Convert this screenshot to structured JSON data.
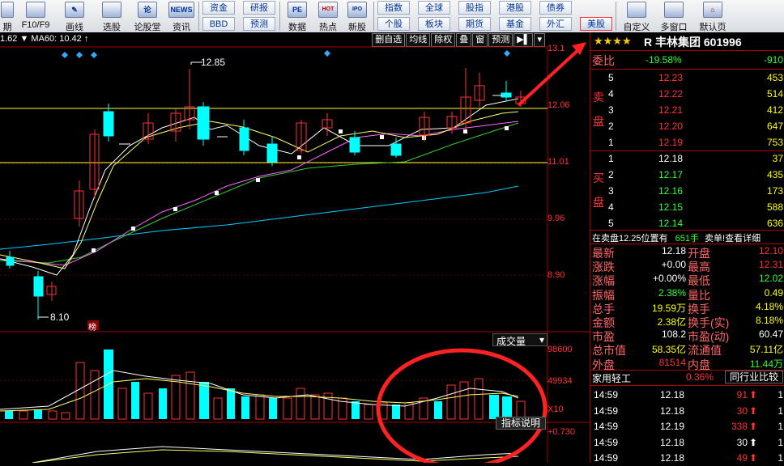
{
  "toolbar": {
    "icon_buttons": [
      {
        "label": "期",
        "icon": "calendar-icon"
      },
      {
        "label": "F10/F9",
        "icon": "f10-icon"
      },
      {
        "label": "画线",
        "icon": "pen-icon"
      },
      {
        "label": "选股",
        "icon": "select-stock-icon"
      },
      {
        "label": "论股堂",
        "icon": "forum-icon",
        "icon_text": "论"
      },
      {
        "label": "资讯",
        "icon": "news-icon",
        "icon_text": "NEWS"
      }
    ],
    "grid1": [
      "资金",
      "研报",
      "BBD",
      "预测"
    ],
    "icon_buttons2": [
      {
        "label": "数据",
        "icon": "data-icon",
        "icon_text": "PE"
      },
      {
        "label": "热点",
        "icon": "hot-icon",
        "icon_text": "HOT"
      },
      {
        "label": "新股",
        "icon": "ipo-icon",
        "icon_text": "IPO"
      }
    ],
    "grid2": [
      "指数",
      "全球",
      "股指",
      "港股",
      "债券",
      "个股",
      "板块",
      "期货",
      "基金",
      "外汇",
      "美股"
    ],
    "right_buttons": [
      {
        "label": "自定义",
        "icon": "custom-icon"
      },
      {
        "label": "多窗口",
        "icon": "multi-window-icon"
      },
      {
        "label": "默认页",
        "icon": "home-icon"
      }
    ]
  },
  "chart": {
    "ma_text": "1.62  ▼  MA60: 10.42 ↑",
    "tabs": [
      "删自选",
      "均线",
      "除权",
      "叠",
      "窗",
      "预测"
    ],
    "price_ticks": [
      "13.1",
      "12.06",
      "11.01",
      "9.96",
      "8.90"
    ],
    "high_label": "12.85",
    "low_label": "8.10",
    "bang_label": "榜",
    "volume_title": "成交量",
    "volume_ticks": [
      "98600",
      "49934",
      "X10"
    ],
    "indicator_button": "指标说明",
    "indicator_tick": "+0.730"
  },
  "quote": {
    "stars": "★★★★",
    "title": "R 丰林集团 601996",
    "weibi_label": "委比",
    "weibi_pct": "-19.58%",
    "weibi_diff": "-910",
    "sell_label": "卖盘",
    "buy_label": "买盘",
    "sell": [
      {
        "n": "5",
        "price": "12.23",
        "vol": "453"
      },
      {
        "n": "4",
        "price": "12.22",
        "vol": "514"
      },
      {
        "n": "3",
        "price": "12.21",
        "vol": "412"
      },
      {
        "n": "2",
        "price": "12.20",
        "vol": "647"
      },
      {
        "n": "1",
        "price": "12.19",
        "vol": "753"
      }
    ],
    "buy": [
      {
        "n": "1",
        "price": "12.18",
        "vol": "37"
      },
      {
        "n": "2",
        "price": "12.17",
        "vol": "435"
      },
      {
        "n": "3",
        "price": "12.16",
        "vol": "173"
      },
      {
        "n": "4",
        "price": "12.15",
        "vol": "588"
      },
      {
        "n": "5",
        "price": "12.14",
        "vol": "636"
      }
    ],
    "notice_text": "在卖盘12.25位置有",
    "notice_vol": "651手",
    "notice_link": "卖单!查看详细",
    "stats": [
      [
        "最新",
        "12.18",
        "开盘",
        "12.10"
      ],
      [
        "涨跌",
        "+0.00",
        "最高",
        "12.31"
      ],
      [
        "涨幅",
        "+0.00%",
        "最低",
        "12.02"
      ],
      [
        "振幅",
        "2.38%",
        "量比",
        "0.49"
      ],
      [
        "总手",
        "19.59万",
        "换手",
        "4.18%"
      ],
      [
        "金额",
        "2.38亿",
        "换手(实)",
        "8.18%"
      ],
      [
        "市盈",
        "108.2",
        "市盈(动)",
        "60.47"
      ],
      [
        "总市值",
        "58.35亿",
        "流通值",
        "57.11亿"
      ],
      [
        "外盘",
        "81514",
        "内盘",
        "11.44万"
      ]
    ],
    "industry": "家用轻工",
    "industry_pct": "0.36%",
    "industry_button": "同行业比较",
    "ticks": [
      {
        "time": "14:59",
        "price": "12.18",
        "vol": "91",
        "dir": "up"
      },
      {
        "time": "14:59",
        "price": "12.18",
        "vol": "30",
        "dir": "up"
      },
      {
        "time": "14:59",
        "price": "12.19",
        "vol": "338",
        "dir": "up"
      },
      {
        "time": "14:59",
        "price": "12.18",
        "vol": "30",
        "dir": "white"
      },
      {
        "time": "14:59",
        "price": "12.18",
        "vol": "49",
        "dir": "up"
      }
    ]
  },
  "colors": {
    "up": "#ff3333",
    "down": "#00ffff",
    "ma5": "#ffffff",
    "ma10": "#ffff66",
    "ma20": "#ff66ff",
    "ma30": "#33cc33",
    "ma60": "#00ccff"
  }
}
